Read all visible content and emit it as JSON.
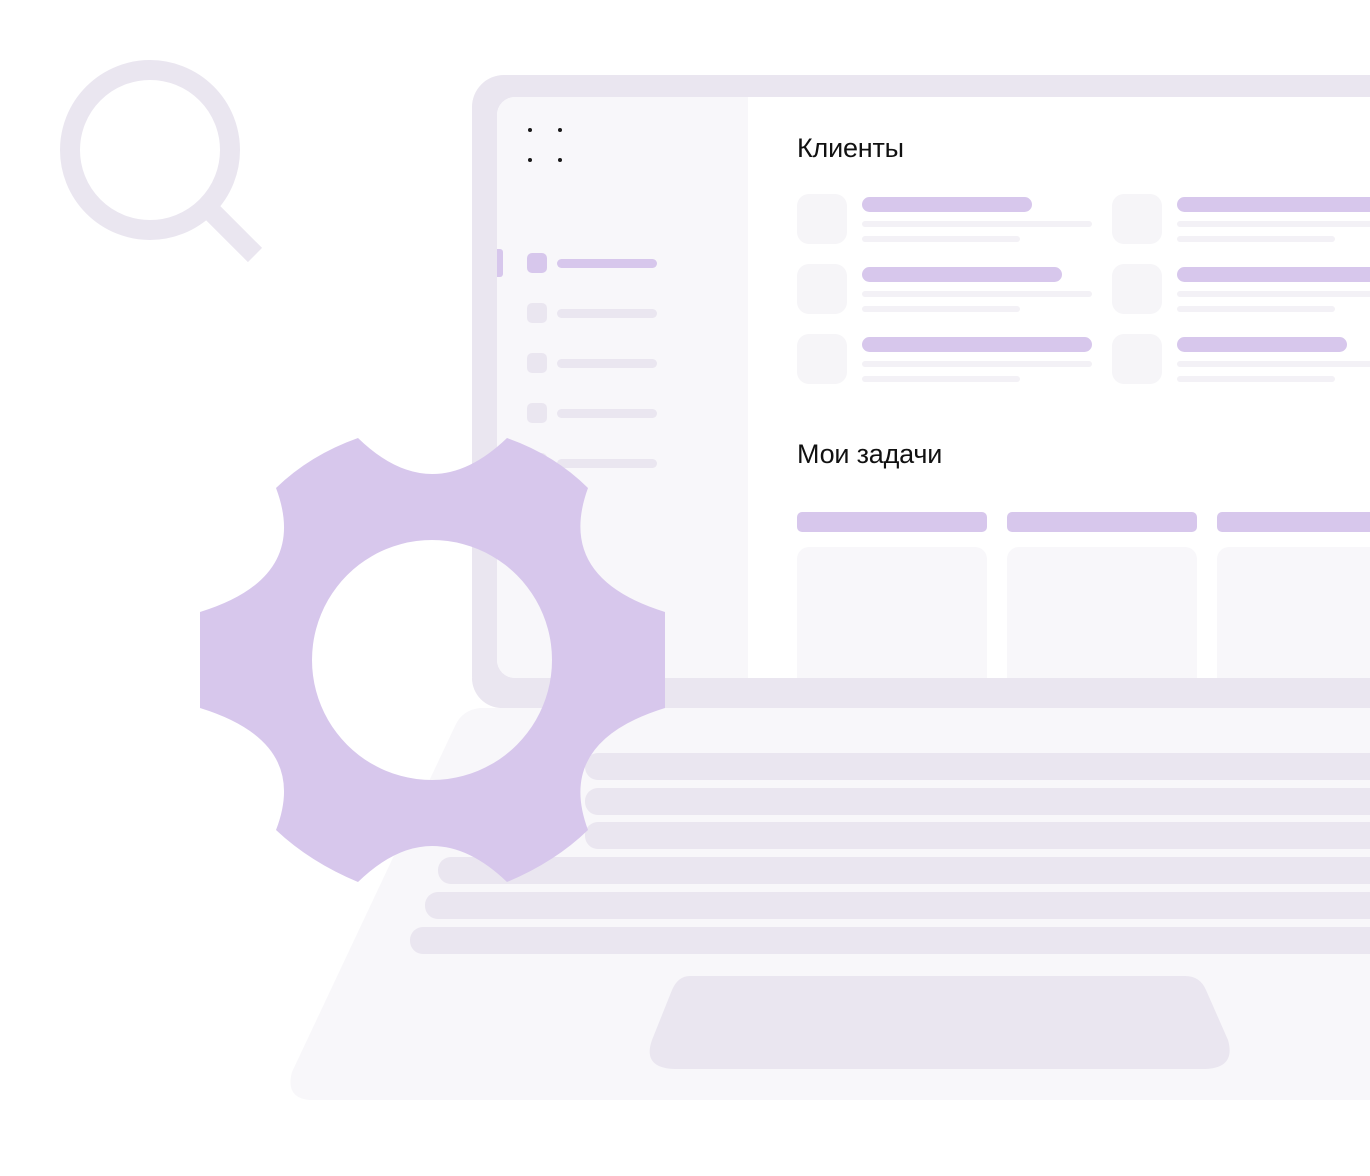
{
  "icons": {
    "search": "search-icon",
    "gear": "gear-icon",
    "menu": "grid-dots-icon"
  },
  "colors": {
    "accent": "#D7C7EC",
    "muted": "#EAE6F0",
    "light": "#F8F7FA"
  },
  "sections": {
    "clients_title": "Клиенты",
    "tasks_title": "Мои задачи"
  }
}
